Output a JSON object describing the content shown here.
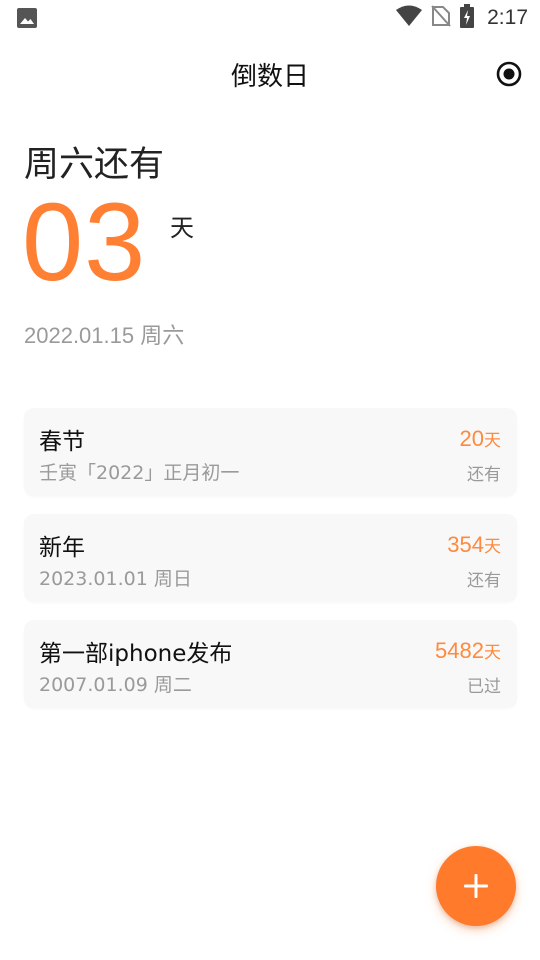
{
  "status_bar": {
    "time": "2:17",
    "icons": [
      "image-icon",
      "wifi-icon",
      "no-sim-icon",
      "battery-charging-icon"
    ]
  },
  "app_bar": {
    "title": "倒数日",
    "action_icon": "target-icon"
  },
  "hero": {
    "label": "周六还有",
    "days": "03",
    "unit": "天",
    "date": "2022.01.15 周六"
  },
  "events": [
    {
      "title": "春节",
      "subtitle": "壬寅「2022」正月初一",
      "days": "20",
      "unit": "天",
      "status": "还有"
    },
    {
      "title": "新年",
      "subtitle": "2023.01.01 周日",
      "days": "354",
      "unit": "天",
      "status": "还有"
    },
    {
      "title": "第一部iphone发布",
      "subtitle": "2007.01.09 周二",
      "days": "5482",
      "unit": "天",
      "status": "已过"
    }
  ],
  "fab": {
    "icon": "plus-icon"
  },
  "colors": {
    "accent": "#ff7f33",
    "card_bg": "#f8f8f8",
    "muted": "#9a9a9a"
  }
}
